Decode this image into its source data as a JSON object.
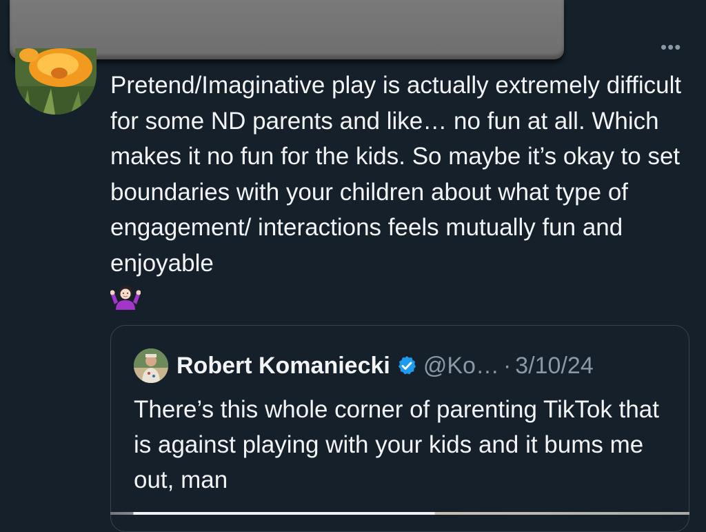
{
  "tweet": {
    "more_icon": "•••",
    "text": "Pretend/Imaginative play is actually extremely difficult for some ND parents and like… no fun at all. Which makes it no fun for the kids. So maybe it’s okay to set boundaries with your children about what type of engagement/ interactions feels mutually fun and enjoyable",
    "emoji": "woman-shrugging-emoji"
  },
  "quoted_tweet": {
    "author_name": "Robert Komaniecki",
    "handle": "@Ko…",
    "separator": "·",
    "date": "3/10/24",
    "text": "There’s this whole corner of parenting TikTok that is against playing with your kids and it bums me out, man",
    "verified_color": "#1d9bf0"
  },
  "colors": {
    "background": "#15202b",
    "text": "#e7e9ea",
    "secondary": "#8b98a5",
    "border": "#38444d"
  }
}
